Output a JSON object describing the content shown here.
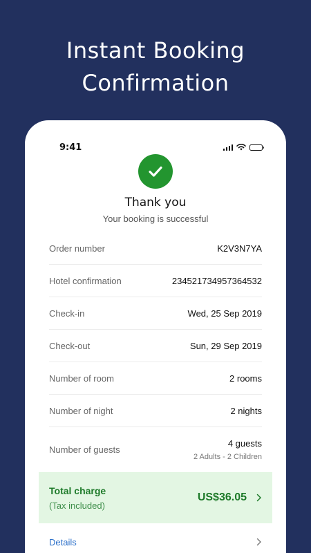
{
  "headline": {
    "line1": "Instant Booking",
    "line2": "Confirmation"
  },
  "status_bar": {
    "time": "9:41",
    "icons": [
      "signal-icon",
      "wifi-icon",
      "battery-icon"
    ]
  },
  "confirmation": {
    "icon": "check-icon",
    "title": "Thank you",
    "subtitle": "Your booking is successful"
  },
  "details": [
    {
      "label": "Order number",
      "value": "K2V3N7YA"
    },
    {
      "label": "Hotel confirmation",
      "value": "234521734957364532"
    },
    {
      "label": "Check-in",
      "value": "Wed, 25 Sep 2019"
    },
    {
      "label": "Check-out",
      "value": "Sun, 29 Sep 2019"
    },
    {
      "label": "Number of room",
      "value": "2 rooms"
    },
    {
      "label": "Number of night",
      "value": "2 nights"
    },
    {
      "label": "Number of guests",
      "value": "4 guests",
      "sub": "2 Adults - 2 Children"
    }
  ],
  "total": {
    "label": "Total charge",
    "note": "(Tax included)",
    "amount": "US$36.05"
  },
  "details_link": {
    "label": "Details"
  },
  "colors": {
    "background": "#22305e",
    "success": "#23952f",
    "total_bg": "#e3f6e3",
    "link": "#2a6fc9"
  }
}
